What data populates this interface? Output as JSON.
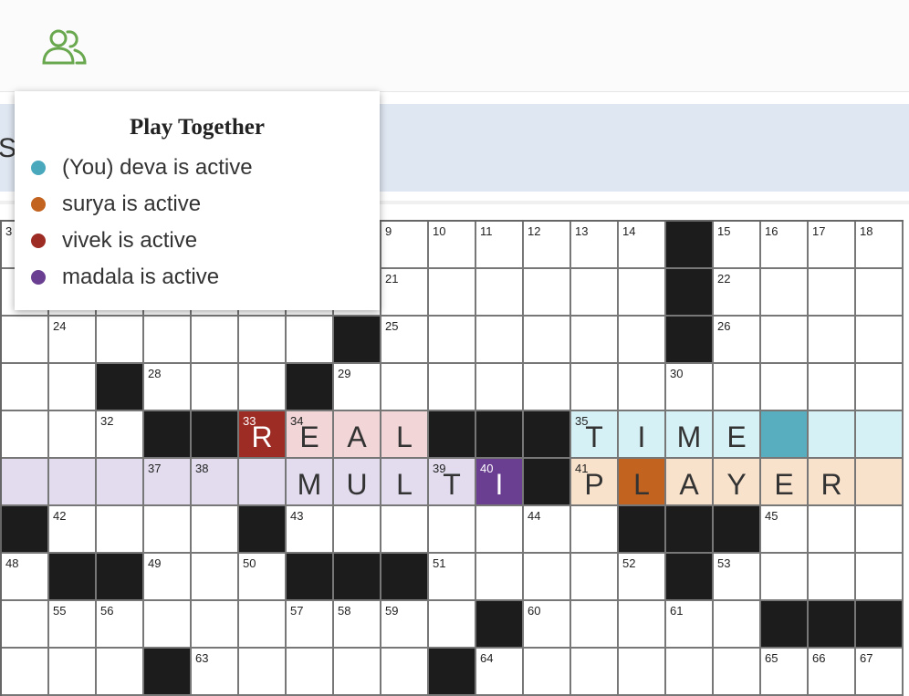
{
  "toolbar": {
    "people_icon": "people-icon",
    "accent_color": "#6aa84f"
  },
  "clue_bar": {
    "visible_text": "S"
  },
  "popup": {
    "title": "Play Together",
    "users": [
      {
        "name": "(You) deva is active",
        "color": "#4aa8bd"
      },
      {
        "name": "surya is active",
        "color": "#c2631f"
      },
      {
        "name": "vivek is active",
        "color": "#9d2c25"
      },
      {
        "name": "madala is active",
        "color": "#6a3f91"
      }
    ]
  },
  "grid": {
    "cols": 19,
    "rows": [
      [
        {
          "n": "3"
        },
        {},
        {},
        {},
        {},
        {},
        {},
        {},
        {
          "n": "9"
        },
        {
          "n": "10"
        },
        {
          "n": "11"
        },
        {
          "n": "12"
        },
        {
          "n": "13"
        },
        {
          "n": "14"
        },
        {
          "b": 1
        },
        {
          "n": "15"
        },
        {
          "n": "16"
        },
        {
          "n": "17"
        },
        {
          "n": "18"
        }
      ],
      [
        {},
        {},
        {},
        {},
        {},
        {},
        {},
        {},
        {
          "n": "21"
        },
        {},
        {},
        {},
        {},
        {},
        {
          "b": 1
        },
        {
          "n": "22"
        },
        {},
        {},
        {}
      ],
      [
        {},
        {
          "n": "24"
        },
        {},
        {},
        {},
        {},
        {},
        {
          "b": 1
        },
        {
          "n": "25"
        },
        {},
        {},
        {},
        {},
        {},
        {
          "b": 1
        },
        {
          "n": "26"
        },
        {},
        {},
        {}
      ],
      [
        {},
        {},
        {
          "b": 1
        },
        {
          "n": "28"
        },
        {},
        {},
        {
          "b": 1
        },
        {
          "n": "29"
        },
        {},
        {},
        {},
        {},
        {},
        {},
        {
          "n": "30"
        },
        {},
        {},
        {},
        {}
      ],
      [
        {},
        {},
        {
          "n": "32"
        },
        {
          "b": 1
        },
        {
          "b": 1
        },
        {
          "n": "33",
          "l": "R",
          "h": "vivek-cur"
        },
        {
          "n": "34",
          "l": "E",
          "h": "vivek-row"
        },
        {
          "l": "A",
          "h": "vivek-row"
        },
        {
          "l": "L",
          "h": "vivek-row"
        },
        {
          "b": 1
        },
        {
          "b": 1
        },
        {
          "b": 1
        },
        {
          "n": "35",
          "l": "T",
          "h": "deva-row"
        },
        {
          "l": "I",
          "h": "deva-row"
        },
        {
          "l": "M",
          "h": "deva-row"
        },
        {
          "l": "E",
          "h": "deva-row"
        },
        {
          "h": "deva-cur"
        },
        {
          "h": "deva-row"
        },
        {
          "h": "deva-row"
        }
      ],
      [
        {
          "h": "madala-row"
        },
        {
          "h": "madala-row"
        },
        {
          "h": "madala-row"
        },
        {
          "n": "37",
          "h": "madala-row"
        },
        {
          "n": "38",
          "h": "madala-row"
        },
        {
          "h": "madala-row"
        },
        {
          "l": "M",
          "h": "madala-row"
        },
        {
          "l": "U",
          "h": "madala-row"
        },
        {
          "l": "L",
          "h": "madala-row"
        },
        {
          "n": "39",
          "l": "T",
          "h": "madala-row"
        },
        {
          "n": "40",
          "l": "I",
          "h": "madala-cur"
        },
        {
          "b": 1
        },
        {
          "n": "41",
          "l": "P",
          "h": "surya-row"
        },
        {
          "l": "L",
          "h": "surya-cur"
        },
        {
          "l": "A",
          "h": "surya-row"
        },
        {
          "l": "Y",
          "h": "surya-row"
        },
        {
          "l": "E",
          "h": "surya-row"
        },
        {
          "l": "R",
          "h": "surya-row"
        },
        {
          "h": "surya-row"
        }
      ],
      [
        {
          "b": 1
        },
        {
          "n": "42"
        },
        {},
        {},
        {},
        {
          "b": 1
        },
        {
          "n": "43"
        },
        {},
        {},
        {},
        {},
        {
          "n": "44"
        },
        {},
        {
          "b": 1
        },
        {
          "b": 1
        },
        {
          "b": 1
        },
        {
          "n": "45"
        },
        {},
        {}
      ],
      [
        {
          "n": "48"
        },
        {
          "b": 1
        },
        {
          "b": 1
        },
        {
          "n": "49"
        },
        {},
        {
          "n": "50"
        },
        {
          "b": 1
        },
        {
          "b": 1
        },
        {
          "b": 1
        },
        {
          "n": "51"
        },
        {},
        {},
        {},
        {
          "n": "52"
        },
        {
          "b": 1
        },
        {
          "n": "53"
        },
        {},
        {},
        {}
      ],
      [
        {},
        {
          "n": "55"
        },
        {
          "n": "56"
        },
        {},
        {},
        {},
        {
          "n": "57"
        },
        {
          "n": "58"
        },
        {
          "n": "59"
        },
        {},
        {
          "b": 1
        },
        {
          "n": "60"
        },
        {},
        {},
        {
          "n": "61"
        },
        {},
        {
          "b": 1
        },
        {
          "b": 1
        },
        {
          "b": 1
        }
      ],
      [
        {},
        {},
        {},
        {
          "b": 1
        },
        {
          "n": "63"
        },
        {},
        {},
        {},
        {},
        {
          "b": 1
        },
        {
          "n": "64"
        },
        {},
        {},
        {},
        {},
        {},
        {
          "n": "65"
        },
        {
          "n": "66"
        },
        {
          "n": "67"
        }
      ]
    ]
  }
}
